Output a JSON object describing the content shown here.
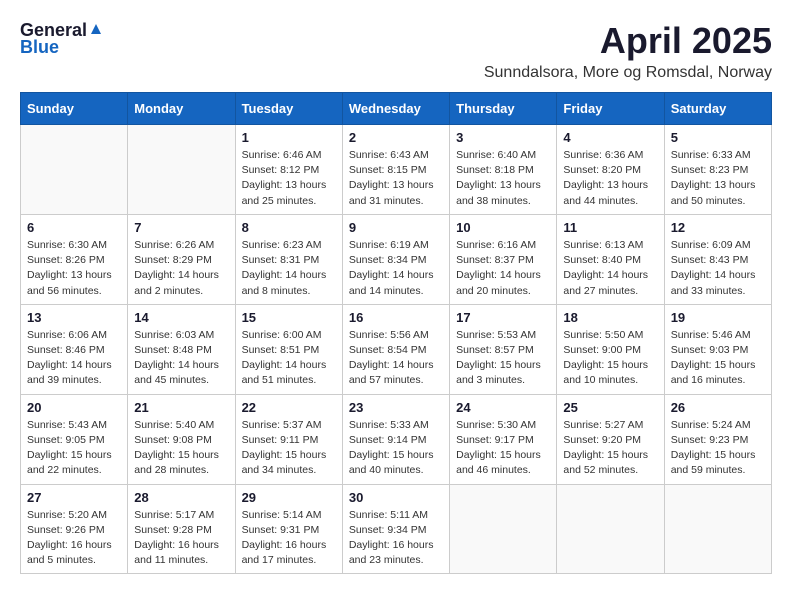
{
  "header": {
    "logo_general": "General",
    "logo_blue": "Blue",
    "month": "April 2025",
    "location": "Sunndalsora, More og Romsdal, Norway"
  },
  "weekdays": [
    "Sunday",
    "Monday",
    "Tuesday",
    "Wednesday",
    "Thursday",
    "Friday",
    "Saturday"
  ],
  "weeks": [
    [
      {
        "day": "",
        "info": ""
      },
      {
        "day": "",
        "info": ""
      },
      {
        "day": "1",
        "info": "Sunrise: 6:46 AM\nSunset: 8:12 PM\nDaylight: 13 hours and 25 minutes."
      },
      {
        "day": "2",
        "info": "Sunrise: 6:43 AM\nSunset: 8:15 PM\nDaylight: 13 hours and 31 minutes."
      },
      {
        "day": "3",
        "info": "Sunrise: 6:40 AM\nSunset: 8:18 PM\nDaylight: 13 hours and 38 minutes."
      },
      {
        "day": "4",
        "info": "Sunrise: 6:36 AM\nSunset: 8:20 PM\nDaylight: 13 hours and 44 minutes."
      },
      {
        "day": "5",
        "info": "Sunrise: 6:33 AM\nSunset: 8:23 PM\nDaylight: 13 hours and 50 minutes."
      }
    ],
    [
      {
        "day": "6",
        "info": "Sunrise: 6:30 AM\nSunset: 8:26 PM\nDaylight: 13 hours and 56 minutes."
      },
      {
        "day": "7",
        "info": "Sunrise: 6:26 AM\nSunset: 8:29 PM\nDaylight: 14 hours and 2 minutes."
      },
      {
        "day": "8",
        "info": "Sunrise: 6:23 AM\nSunset: 8:31 PM\nDaylight: 14 hours and 8 minutes."
      },
      {
        "day": "9",
        "info": "Sunrise: 6:19 AM\nSunset: 8:34 PM\nDaylight: 14 hours and 14 minutes."
      },
      {
        "day": "10",
        "info": "Sunrise: 6:16 AM\nSunset: 8:37 PM\nDaylight: 14 hours and 20 minutes."
      },
      {
        "day": "11",
        "info": "Sunrise: 6:13 AM\nSunset: 8:40 PM\nDaylight: 14 hours and 27 minutes."
      },
      {
        "day": "12",
        "info": "Sunrise: 6:09 AM\nSunset: 8:43 PM\nDaylight: 14 hours and 33 minutes."
      }
    ],
    [
      {
        "day": "13",
        "info": "Sunrise: 6:06 AM\nSunset: 8:46 PM\nDaylight: 14 hours and 39 minutes."
      },
      {
        "day": "14",
        "info": "Sunrise: 6:03 AM\nSunset: 8:48 PM\nDaylight: 14 hours and 45 minutes."
      },
      {
        "day": "15",
        "info": "Sunrise: 6:00 AM\nSunset: 8:51 PM\nDaylight: 14 hours and 51 minutes."
      },
      {
        "day": "16",
        "info": "Sunrise: 5:56 AM\nSunset: 8:54 PM\nDaylight: 14 hours and 57 minutes."
      },
      {
        "day": "17",
        "info": "Sunrise: 5:53 AM\nSunset: 8:57 PM\nDaylight: 15 hours and 3 minutes."
      },
      {
        "day": "18",
        "info": "Sunrise: 5:50 AM\nSunset: 9:00 PM\nDaylight: 15 hours and 10 minutes."
      },
      {
        "day": "19",
        "info": "Sunrise: 5:46 AM\nSunset: 9:03 PM\nDaylight: 15 hours and 16 minutes."
      }
    ],
    [
      {
        "day": "20",
        "info": "Sunrise: 5:43 AM\nSunset: 9:05 PM\nDaylight: 15 hours and 22 minutes."
      },
      {
        "day": "21",
        "info": "Sunrise: 5:40 AM\nSunset: 9:08 PM\nDaylight: 15 hours and 28 minutes."
      },
      {
        "day": "22",
        "info": "Sunrise: 5:37 AM\nSunset: 9:11 PM\nDaylight: 15 hours and 34 minutes."
      },
      {
        "day": "23",
        "info": "Sunrise: 5:33 AM\nSunset: 9:14 PM\nDaylight: 15 hours and 40 minutes."
      },
      {
        "day": "24",
        "info": "Sunrise: 5:30 AM\nSunset: 9:17 PM\nDaylight: 15 hours and 46 minutes."
      },
      {
        "day": "25",
        "info": "Sunrise: 5:27 AM\nSunset: 9:20 PM\nDaylight: 15 hours and 52 minutes."
      },
      {
        "day": "26",
        "info": "Sunrise: 5:24 AM\nSunset: 9:23 PM\nDaylight: 15 hours and 59 minutes."
      }
    ],
    [
      {
        "day": "27",
        "info": "Sunrise: 5:20 AM\nSunset: 9:26 PM\nDaylight: 16 hours and 5 minutes."
      },
      {
        "day": "28",
        "info": "Sunrise: 5:17 AM\nSunset: 9:28 PM\nDaylight: 16 hours and 11 minutes."
      },
      {
        "day": "29",
        "info": "Sunrise: 5:14 AM\nSunset: 9:31 PM\nDaylight: 16 hours and 17 minutes."
      },
      {
        "day": "30",
        "info": "Sunrise: 5:11 AM\nSunset: 9:34 PM\nDaylight: 16 hours and 23 minutes."
      },
      {
        "day": "",
        "info": ""
      },
      {
        "day": "",
        "info": ""
      },
      {
        "day": "",
        "info": ""
      }
    ]
  ]
}
